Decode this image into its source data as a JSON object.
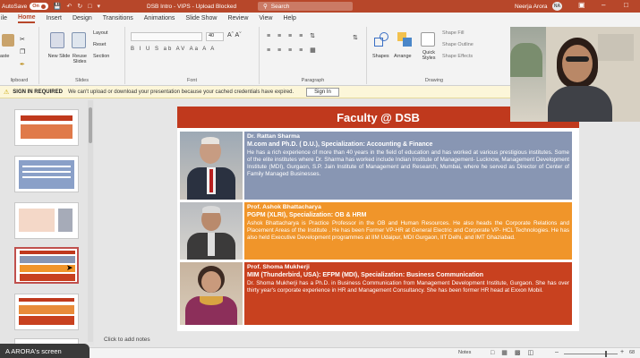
{
  "titlebar": {
    "autosave_label": "AutoSave",
    "autosave_state": "On",
    "doc_title": "DSB Intro - VIPS  -  Upload Blocked",
    "doc_title_sep": "•",
    "search_placeholder": "Search",
    "user_name": "Neerja Arora",
    "user_initials": "NA",
    "brand_color": "#b7472a"
  },
  "tabs": [
    "ile",
    "Home",
    "Insert",
    "Design",
    "Transitions",
    "Animations",
    "Slide Show",
    "Review",
    "View",
    "Help"
  ],
  "ribbon": {
    "groups": {
      "clipboard": "lipboard",
      "slides": "Slides",
      "font": "Font",
      "paragraph": "Paragraph",
      "drawing": "Drawing"
    },
    "paste_label": "aste",
    "new_slide_label": "New Slide",
    "reuse_slides_label": "Reuse Slides",
    "layout_label": "Layout",
    "reset_label": "Reset",
    "section_label": "Section",
    "shapes_label": "Shapes",
    "arrange_label": "Arrange",
    "quick_styles_label": "Quick Styles",
    "shape_fill_label": "Shape Fill",
    "shape_outline_label": "Shape Outline",
    "shape_effects_label": "Shape Effects",
    "font_format_row": "B  I  U  S  ab  AV  Aa  A  A",
    "font_size": "40"
  },
  "notice": {
    "title": "SIGN IN REQUIRED",
    "message": "We can't upload or download your presentation because your cached credentials have expired.",
    "button": "Sign In"
  },
  "thumbnails": {
    "numbers": [
      "",
      "",
      "",
      "",
      "",
      ""
    ],
    "selected_index": 3
  },
  "slide": {
    "title": "Faculty @ DSB",
    "header_color": "#c0391d",
    "faculty": [
      {
        "name": "Dr. Rattan Sharma",
        "qualification": "M.com and Ph.D. ( D.U.), Specialization: Accounting & Finance",
        "bio": "He has a rich experience of more than 40 years in the field of education and has worked at various prestigious institutes. Some of the elite institutes where Dr. Sharma has worked include Indian Institute of Management- Lucknow, Management Development Institute (MDI), Gurgaon, S.P. Jain Institute of Management and Research, Mumbai, where he served as Director of Center of Family Managed Businesses.",
        "box_color": "#8896b3",
        "qual_color": "#ffffff"
      },
      {
        "name": "Prof. Ashok Bhattacharya",
        "qualification": "PGPM (XLRI), Specialization: OB & HRM",
        "bio": "Ashok Bhattacharya is Practice Professor in the OB and Human Resources. He also heads the Corporate Relations and Placement Areas of the Institute . He has been Former VP-HR at General Electric and Corporate VP- HCL Technologies. He has also held Executive Development programmes at IIM Udaipur, MDI Gurgaon, IIT Delhi, and IMT Ghaziabad.",
        "box_color": "#f0952a",
        "qual_color": "#ffffff"
      },
      {
        "name": "Prof. Shoma Mukherji",
        "qualification": "MIM (Thunderbird, USA): EFPM (MDI), Specialization: Business Communication",
        "bio": "Dr. Shoma Mukherji has a Ph.D. in Business Communication from Management Development Institute, Gurgaon. She has over thirty year's corporate experience in HR and Management Consultancy. She has been former HR head at Exxon Mobil.",
        "box_color": "#c8411f",
        "qual_color": "#ffffff"
      }
    ]
  },
  "notes_placeholder": "Click to add notes",
  "screen_label": "A ARORA's screen",
  "status": {
    "notes_label": "Notes",
    "zoom": "68"
  }
}
